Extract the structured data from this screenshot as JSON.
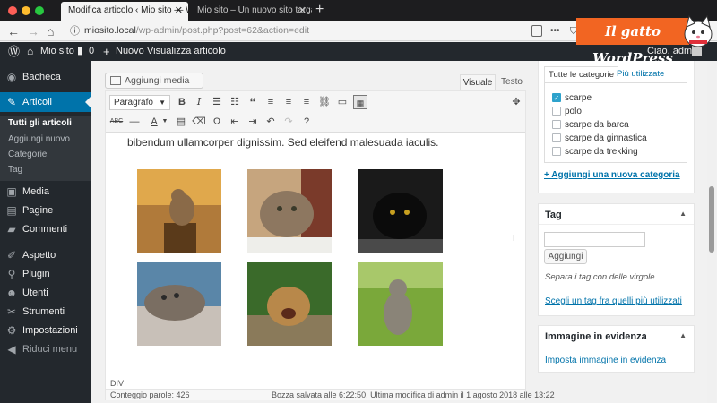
{
  "browser": {
    "tabs": [
      {
        "title": "Modifica articolo ‹ Mio sito — Word",
        "active": true
      },
      {
        "title": "Mio sito – Un nuovo sito targato Wor",
        "active": false
      }
    ],
    "url_host": "miosito.local",
    "url_path": "/wp-admin/post.php?post=62&action=edit",
    "icons": [
      "back-arrow",
      "forward-arrow",
      "home",
      "reader",
      "pocket",
      "download",
      "menu"
    ]
  },
  "logo": {
    "text": "Il gatto WordPress",
    "color": "#f26522"
  },
  "adminbar": {
    "site_name": "Mio sito",
    "comments_count": "0",
    "new_label": "Nuovo",
    "view_label": "Visualizza articolo",
    "greeting": "Ciao, admin"
  },
  "sidebar": {
    "items": [
      {
        "label": "Bacheca",
        "icon": "dashboard-icon"
      },
      {
        "label": "Articoli",
        "icon": "pin-icon",
        "current": true
      },
      {
        "label": "Media",
        "icon": "media-icon"
      },
      {
        "label": "Pagine",
        "icon": "page-icon"
      },
      {
        "label": "Commenti",
        "icon": "comment-icon"
      },
      {
        "label": "Aspetto",
        "icon": "brush-icon"
      },
      {
        "label": "Plugin",
        "icon": "plugin-icon"
      },
      {
        "label": "Utenti",
        "icon": "user-icon"
      },
      {
        "label": "Strumenti",
        "icon": "wrench-icon"
      },
      {
        "label": "Impostazioni",
        "icon": "settings-icon"
      },
      {
        "label": "Riduci menu",
        "icon": "collapse-icon"
      }
    ],
    "submenu": [
      "Tutti gli articoli",
      "Aggiungi nuovo",
      "Categorie",
      "Tag"
    ]
  },
  "editor": {
    "add_media_label": "Aggiungi media",
    "tab_visual": "Visuale",
    "tab_text": "Testo",
    "format_value": "Paragrafo",
    "content_text": "bibendum ullamcorper dignissim. Sed eleifend malesuada iaculis.",
    "gallery_alt": [
      "gatto su cassetta",
      "gatto tigrato sdraiato",
      "gatto nero",
      "gatto sdraiato di lato",
      "gatto che sbadiglia",
      "gattino seduto"
    ],
    "path": "DIV",
    "word_count": "Conteggio parole: 426",
    "save_status": "Bozza salvata alle 6:22:50. Ultima modifica di admin il 1 agosto 2018 alle 13:22"
  },
  "categories": {
    "tab_all": "Tutte le categorie",
    "tab_used": "Più utilizzate",
    "items": [
      {
        "label": "scarpe",
        "checked": true
      },
      {
        "label": "polo",
        "checked": false
      },
      {
        "label": "scarpe da barca",
        "checked": false
      },
      {
        "label": "scarpe da ginnastica",
        "checked": false
      },
      {
        "label": "scarpe da trekking",
        "checked": false
      }
    ],
    "add_link": "+ Aggiungi una nuova categoria"
  },
  "tags": {
    "title": "Tag",
    "input_value": "",
    "add_button": "Aggiungi",
    "hint": "Separa i tag con delle virgole",
    "choose_link": "Scegli un tag fra quelli più utilizzati"
  },
  "featured": {
    "title": "Immagine in evidenza",
    "link": "Imposta immagine in evidenza"
  },
  "colors": {
    "accent": "#0073aa",
    "adminbar": "#23282d",
    "logo": "#f26522"
  }
}
